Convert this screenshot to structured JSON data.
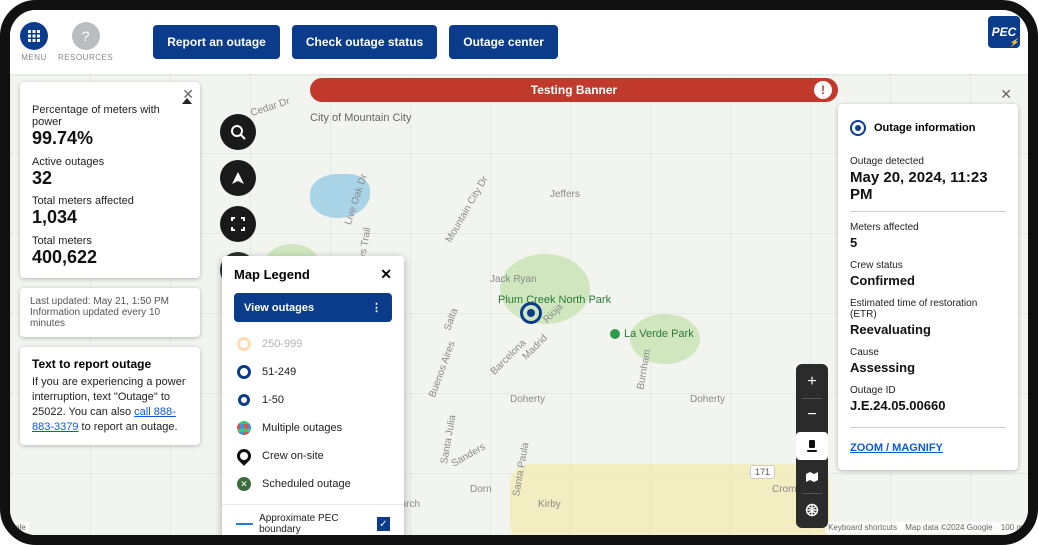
{
  "header": {
    "menu_label": "MENU",
    "resources_label": "RESOURCES",
    "actions": {
      "report": "Report an outage",
      "status": "Check outage status",
      "center": "Outage center"
    },
    "logo_text": "PEC"
  },
  "banner": {
    "text": "Testing Banner"
  },
  "stats": {
    "pct_label": "Percentage of meters with power",
    "pct_value": "99.74%",
    "active_label": "Active outages",
    "active_value": "32",
    "affected_label": "Total meters affected",
    "affected_value": "1,034",
    "total_label": "Total meters",
    "total_value": "400,622"
  },
  "updated": {
    "last": "Last updated:  May 21, 1:50 PM",
    "note": "Information updated every 10 minutes"
  },
  "text_report": {
    "title": "Text to report outage",
    "body_pre": "If you are experiencing a power interruption, text \"Outage\" to 25022. You can also ",
    "phone": "call 888-883-3379",
    "body_post": " to report an outage."
  },
  "legend": {
    "title": "Map Legend",
    "view_label": "View outages",
    "items": [
      {
        "label": "250-999"
      },
      {
        "label": "51-249"
      },
      {
        "label": "1-50"
      },
      {
        "label": "Multiple outages"
      },
      {
        "label": "Crew on-site"
      },
      {
        "label": "Scheduled outage"
      }
    ],
    "boundary_label": "Approximate PEC boundary"
  },
  "map_labels": {
    "city": "City of Mountain City",
    "park1": "Plum Creek North Park",
    "park2": "La Verde Park",
    "cedar": "Cedar Dr",
    "liveoak": "Live Oak Dr",
    "hays": "Hays Trail",
    "mcd": "Mountain City Dr",
    "jeffers": "Jeffers",
    "jack": "Jack Ryan",
    "salta": "Salta",
    "rioja": "Rioja",
    "madrid": "Madrid",
    "barcelona": "Barcelona",
    "burnham": "Burnham",
    "doherty": "Doherty",
    "doherty2": "Doherty",
    "buenos": "Buenos Aires",
    "julia": "Santa Julia",
    "sanders": "Sanders",
    "paula": "Santa Paula",
    "dorn": "Dorn",
    "kirby": "Kirby",
    "church": "church",
    "cromwell": "Cromwell Ct",
    "route": "171"
  },
  "right_panel": {
    "title": "Outage information",
    "detected_label": "Outage detected",
    "detected_value": "May 20, 2024, 11:23 PM",
    "meters_label": "Meters affected",
    "meters_value": "5",
    "crew_label": "Crew status",
    "crew_value": "Confirmed",
    "etr_label": "Estimated time of restoration (ETR)",
    "etr_value": "Reevaluating",
    "cause_label": "Cause",
    "cause_value": "Assessing",
    "id_label": "Outage ID",
    "id_value": "J.E.24.05.00660",
    "zoom": "ZOOM / MAGNIFY"
  },
  "attrib": {
    "shortcuts": "Keyboard shortcuts",
    "mapdata": "Map data ©2024 Google",
    "scale": "100 m",
    "google": "gle"
  }
}
